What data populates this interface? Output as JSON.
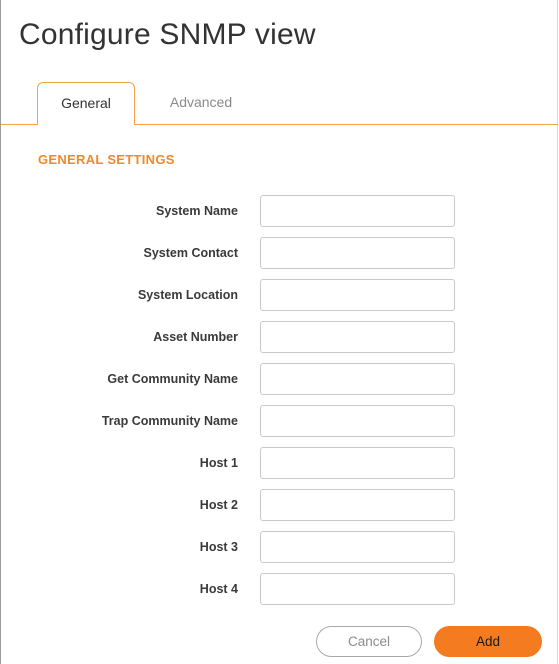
{
  "dialog": {
    "title": "Configure SNMP view"
  },
  "tabs": [
    {
      "label": "General",
      "active": true
    },
    {
      "label": "Advanced",
      "active": false
    }
  ],
  "section": {
    "title": "GENERAL SETTINGS"
  },
  "fields": [
    {
      "label": "System Name",
      "value": ""
    },
    {
      "label": "System Contact",
      "value": ""
    },
    {
      "label": "System Location",
      "value": ""
    },
    {
      "label": "Asset Number",
      "value": ""
    },
    {
      "label": "Get Community Name",
      "value": ""
    },
    {
      "label": "Trap Community Name",
      "value": ""
    },
    {
      "label": "Host 1",
      "value": ""
    },
    {
      "label": "Host 2",
      "value": ""
    },
    {
      "label": "Host 3",
      "value": ""
    },
    {
      "label": "Host 4",
      "value": ""
    }
  ],
  "buttons": {
    "cancel_label": "Cancel",
    "add_label": "Add"
  },
  "colors": {
    "accent": "#f47b20",
    "section_title": "#f08a24",
    "tab_border": "#f5a04b"
  }
}
